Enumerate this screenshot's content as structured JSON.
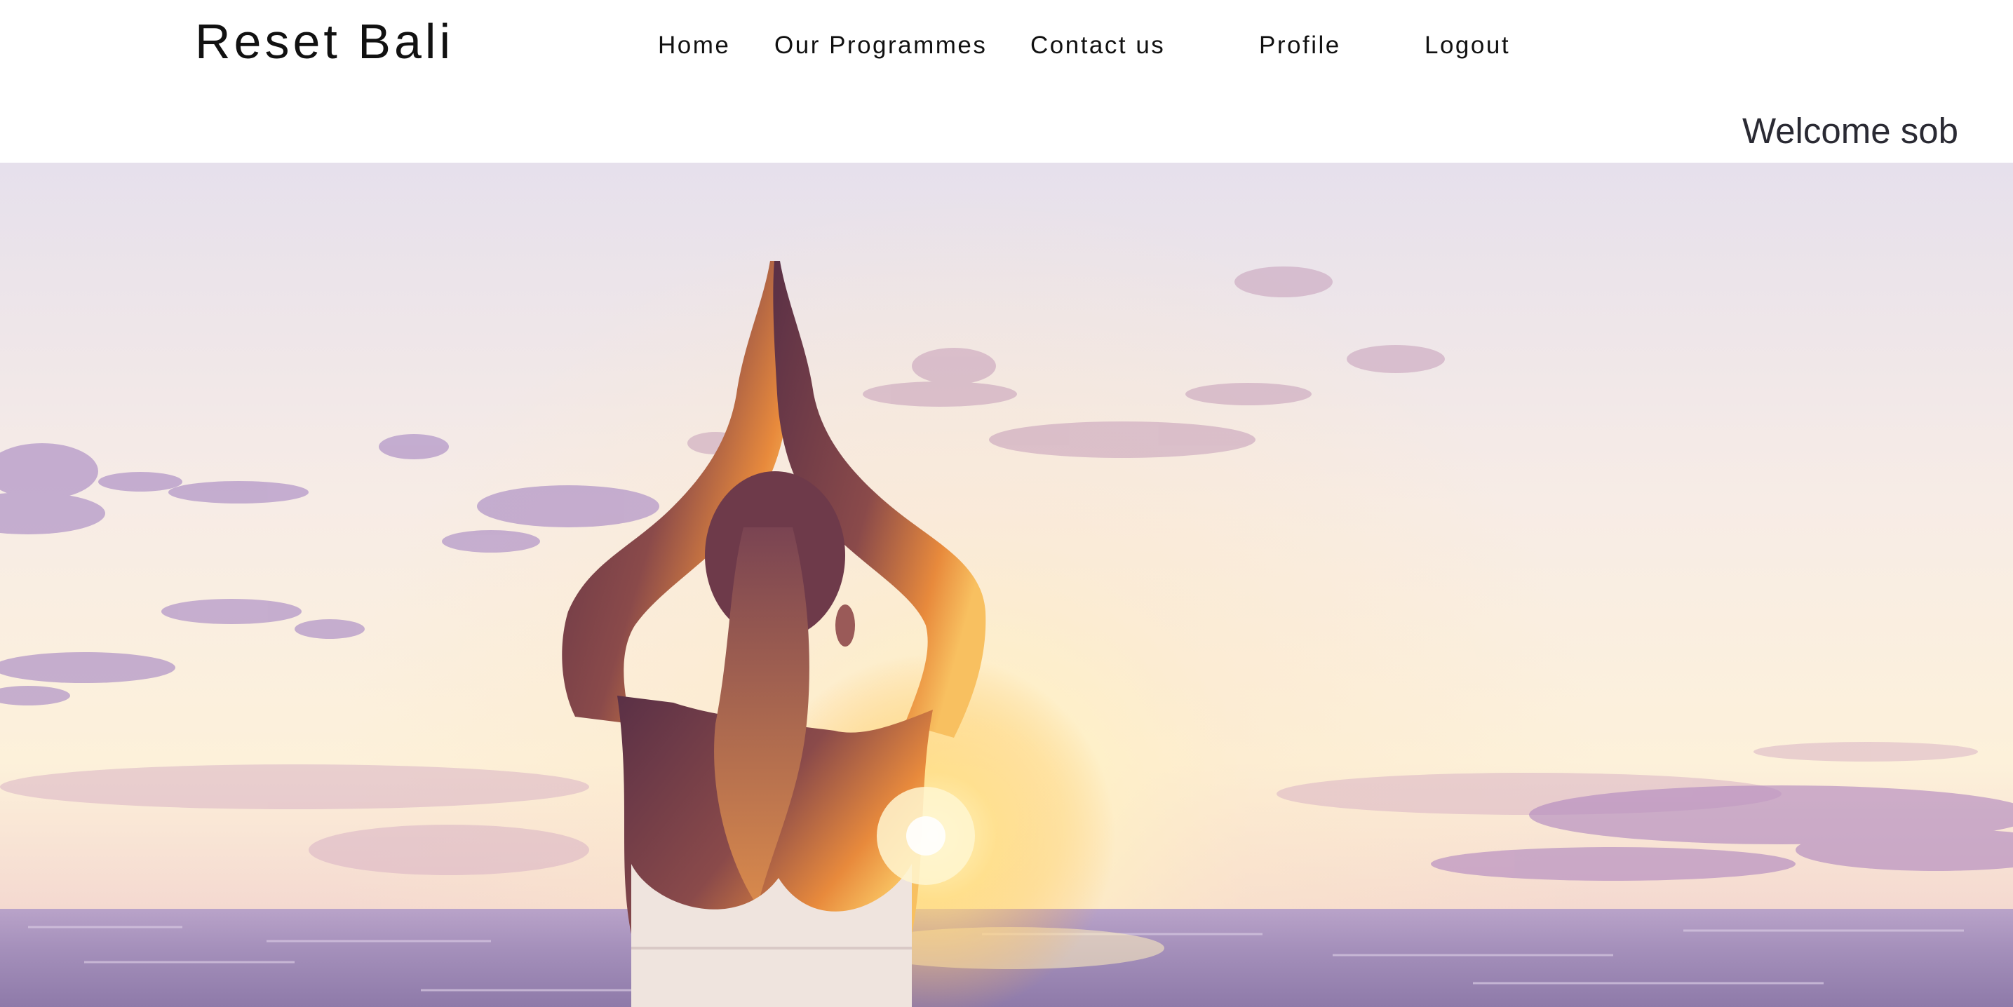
{
  "header": {
    "brand": "Reset Bali",
    "nav": {
      "home": "Home",
      "programmes": "Our Programmes",
      "contact": "Contact us",
      "profile": "Profile",
      "logout": "Logout"
    },
    "welcome": "Welcome sob"
  },
  "hero": {
    "image_subject": "woman-yoga-sunset-ocean",
    "colors": {
      "sky_top": "#e8e2ee",
      "sky_glow": "#fff4d8",
      "sun": "#fff6c0",
      "cloud": "#b79ac8",
      "sea": "#9d88b4",
      "silhouette": "#6a3a4e",
      "skin_glow": "#e8904a"
    }
  }
}
